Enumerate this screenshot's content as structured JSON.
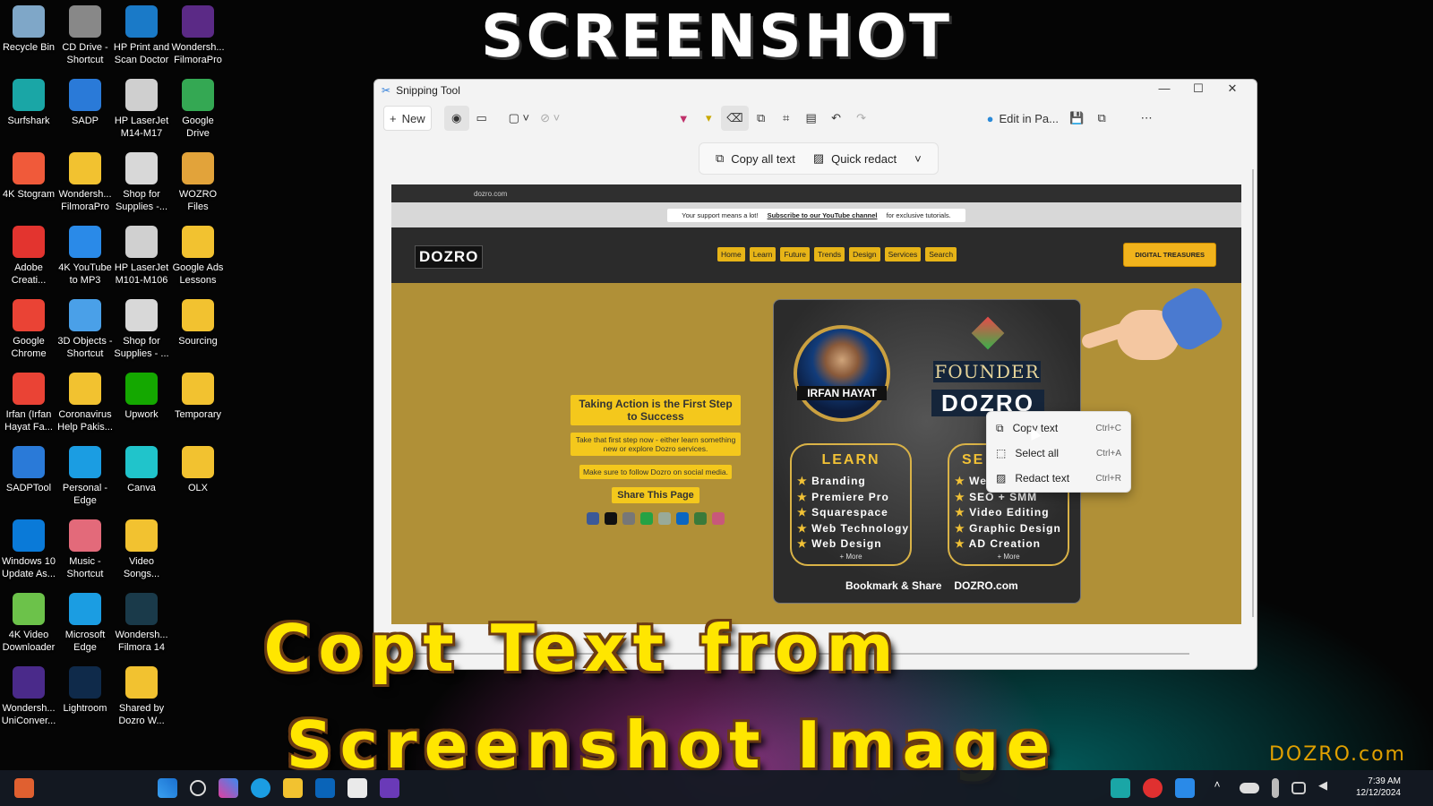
{
  "headline": "SCREENSHOT",
  "caption_line1": "Copt Text from",
  "caption_line2": "Screenshot Image",
  "watermark": "DOZRO.com",
  "desktop_icons": [
    {
      "label": "Recycle Bin",
      "color": "#7fa7c8"
    },
    {
      "label": "CD Drive - Shortcut",
      "color": "#888"
    },
    {
      "label": "HP Print and Scan Doctor",
      "color": "#1a7ac8"
    },
    {
      "label": "Wondersh... FilmoraPro",
      "color": "#5b2a86"
    },
    {
      "label": "Surfshark",
      "color": "#1aa6a6"
    },
    {
      "label": "SADP",
      "color": "#2a7ad8"
    },
    {
      "label": "HP LaserJet M14-M17",
      "color": "#cfcfcf"
    },
    {
      "label": "Google Drive",
      "color": "#34a853"
    },
    {
      "label": "4K Stogram",
      "color": "#f05a3a"
    },
    {
      "label": "Wondersh... FilmoraPro",
      "color": "#f2c230"
    },
    {
      "label": "Shop for Supplies -...",
      "color": "#d8d8d8"
    },
    {
      "label": "WOZRO Files",
      "color": "#e2a33a"
    },
    {
      "label": "Adobe Creati...",
      "color": "#e3342f"
    },
    {
      "label": "4K YouTube to MP3",
      "color": "#2a8ae8"
    },
    {
      "label": "HP LaserJet M101-M106",
      "color": "#d0d0d0"
    },
    {
      "label": "Google Ads Lessons",
      "color": "#f2c230"
    },
    {
      "label": "Google Chrome",
      "color": "#ea4335"
    },
    {
      "label": "3D Objects - Shortcut",
      "color": "#4aa0e8"
    },
    {
      "label": "Shop for Supplies - ...",
      "color": "#d8d8d8"
    },
    {
      "label": "Sourcing",
      "color": "#f2c230"
    },
    {
      "label": "Irfan (Irfan Hayat Fa...",
      "color": "#ea4335"
    },
    {
      "label": "Coronavirus Help Pakis...",
      "color": "#f2c230"
    },
    {
      "label": "Upwork",
      "color": "#14a800"
    },
    {
      "label": "Temporary",
      "color": "#f2c230"
    },
    {
      "label": "SADPTool",
      "color": "#2a7ad8"
    },
    {
      "label": "Personal - Edge",
      "color": "#1b9de2"
    },
    {
      "label": "Canva",
      "color": "#20c4cb"
    },
    {
      "label": "OLX",
      "color": "#f2c230"
    },
    {
      "label": "Windows 10 Update As...",
      "color": "#0a7ad8"
    },
    {
      "label": "Music - Shortcut",
      "color": "#e36a7a"
    },
    {
      "label": "Video Songs...",
      "color": "#f2c230"
    },
    {
      "label": "4K Video Downloader",
      "color": "#6cc24a"
    },
    {
      "label": "Microsoft Edge",
      "color": "#1b9de2"
    },
    {
      "label": "Wondersh... Filmora 14",
      "color": "#1a3a4a"
    },
    {
      "label": "Wondersh... UniConver...",
      "color": "#4a2a8a"
    },
    {
      "label": "Lightroom",
      "color": "#0f2a4a"
    },
    {
      "label": "Shared by Dozro W...",
      "color": "#f2c230"
    }
  ],
  "window": {
    "title": "Snipping Tool",
    "new_label": "New",
    "edit_label": "Edit in Pa...",
    "copy_all": "Copy all text",
    "quick_redact": "Quick redact"
  },
  "site": {
    "url": "dozro.com",
    "notice_pre": "Your support means a lot!",
    "notice_link": "Subscribe to our YouTube channel",
    "notice_post": "for exclusive tutorials.",
    "logo": "DOZRO",
    "nav": [
      "Home",
      "Learn",
      "Future",
      "Trends",
      "Design",
      "Services",
      "Search"
    ],
    "treasures": "DIGITAL TREASURES",
    "hero_title": "Taking Action is the First Step to Success",
    "hero_sub": "Take that first step now - either learn something new or explore Dozro services.",
    "hero_follow": "Make sure to follow Dozro on social media.",
    "share": "Share This Page",
    "name": "IRFAN HAYAT",
    "founder": "FOUNDER",
    "brand": "DOZRO",
    "learn_title": "LEARN",
    "learn_items": [
      "Branding",
      "Premiere Pro",
      "Squarespace",
      "Web Technology",
      "Web Design"
    ],
    "serv_title": "SE",
    "serv_items": [
      "Web",
      "SEO + SMM",
      "Video Editing",
      "Graphic Design",
      "AD Creation"
    ],
    "more": "+ More",
    "bookmark": "Bookmark & Share",
    "dozro_com": "DOZRO.com"
  },
  "context_menu": [
    {
      "label": "Copy text",
      "shortcut": "Ctrl+C"
    },
    {
      "label": "Select all",
      "shortcut": "Ctrl+A"
    },
    {
      "label": "Redact text",
      "shortcut": "Ctrl+R"
    }
  ],
  "clock": {
    "time": "7:39 AM",
    "date": "12/12/2024"
  }
}
